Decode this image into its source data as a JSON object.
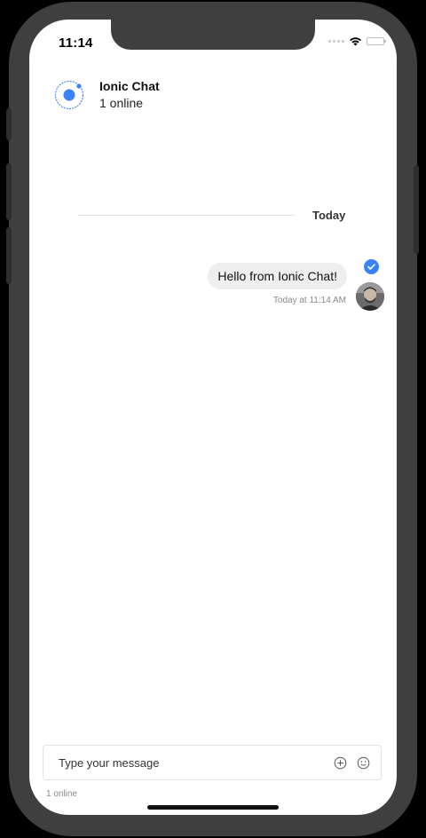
{
  "status_bar": {
    "time": "11:14"
  },
  "header": {
    "title": "Ionic Chat",
    "subtitle": "1 online",
    "logo_icon": "ionic-logo-icon"
  },
  "divider": {
    "label": "Today"
  },
  "messages": [
    {
      "text": "Hello from Ionic Chat!",
      "timestamp": "Today at 11:14 AM",
      "status_icon": "check-circle-icon",
      "avatar": "user-avatar"
    }
  ],
  "composer": {
    "placeholder": "Type your message",
    "value": "",
    "attach_icon": "plus-circle-icon",
    "emoji_icon": "smiley-icon"
  },
  "footer": {
    "status": "1 online"
  },
  "colors": {
    "accent": "#3b82f6",
    "frame": "#3f3f3f",
    "bubble": "#eeeeee"
  }
}
